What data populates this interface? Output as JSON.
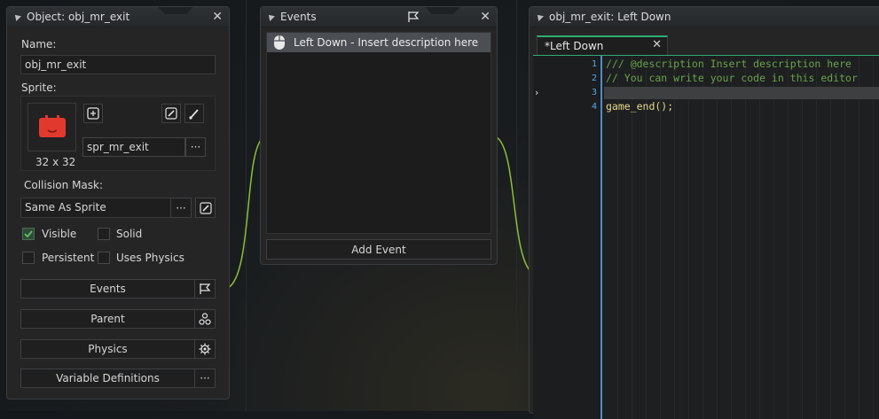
{
  "object_panel": {
    "title": "Object: obj_mr_exit",
    "name_label": "Name:",
    "name_value": "obj_mr_exit",
    "sprite_label": "Sprite:",
    "sprite_size": "32 x 32",
    "sprite_name": "spr_mr_exit",
    "browse_label": "···",
    "collision_label": "Collision Mask:",
    "collision_value": "Same As Sprite",
    "collision_browse": "···",
    "visible_label": "Visible",
    "solid_label": "Solid",
    "persistent_label": "Persistent",
    "physics_check_label": "Uses Physics",
    "visible_checked": true,
    "events_btn": "Events",
    "parent_btn": "Parent",
    "physics_btn": "Physics",
    "vardefs_btn": "Variable Definitions",
    "vardefs_more": "···"
  },
  "events_panel": {
    "title": "Events",
    "items": [
      "Left Down - Insert description here"
    ],
    "add_event": "Add Event"
  },
  "code_panel": {
    "title": "obj_mr_exit: Left Down",
    "tab_label": "*Left Down",
    "lines": [
      {
        "num": "1",
        "text": "/// @description Insert description here"
      },
      {
        "num": "2",
        "text": "// You can write your code in this editor"
      },
      {
        "num": "3",
        "text": ""
      },
      {
        "num": "4",
        "text": "game_end();"
      }
    ]
  },
  "colors": {
    "accent_green": "#7ec94a",
    "comment": "#6aa24a",
    "sprite_red": "#e2392f"
  }
}
